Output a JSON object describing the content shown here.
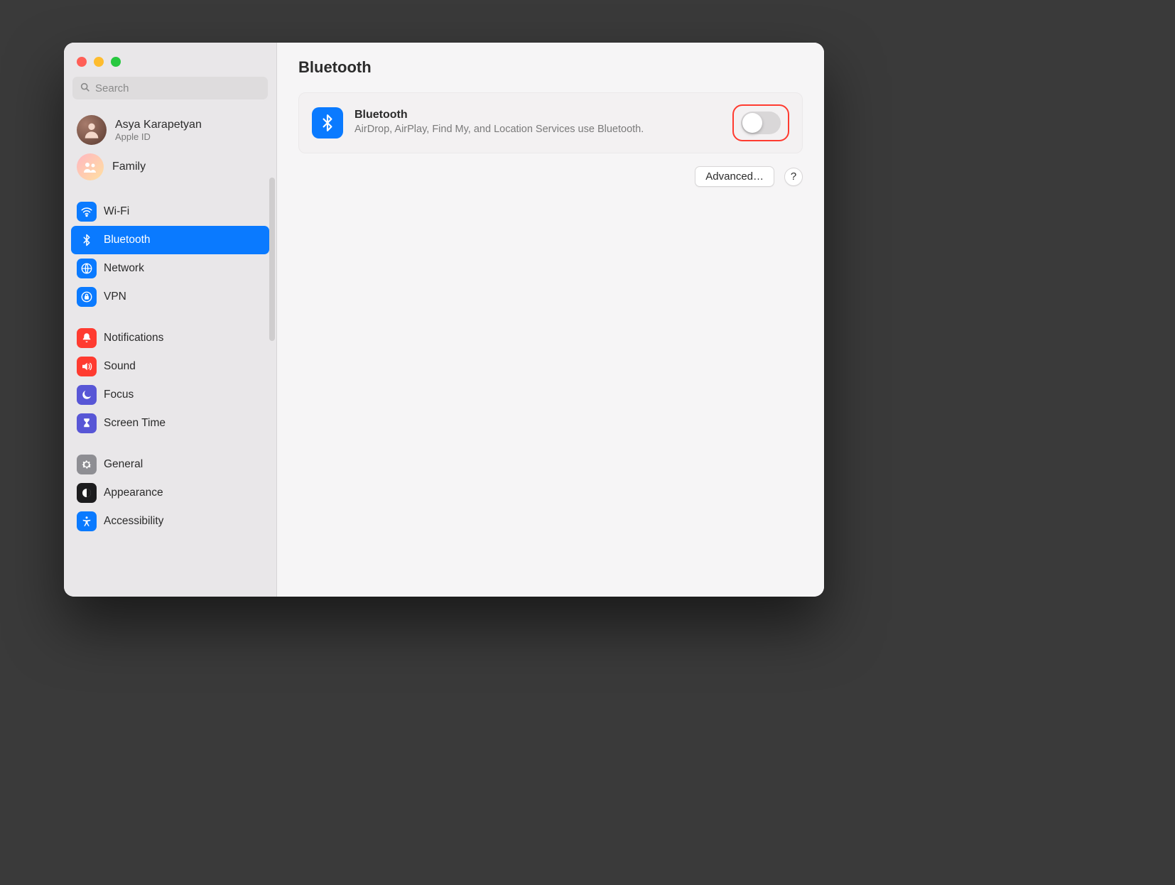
{
  "search": {
    "placeholder": "Search"
  },
  "profile": {
    "name": "Asya Karapetyan",
    "subtitle": "Apple ID"
  },
  "family": {
    "label": "Family"
  },
  "sidebar": {
    "groups": [
      {
        "items": [
          {
            "label": "Wi-Fi"
          },
          {
            "label": "Bluetooth"
          },
          {
            "label": "Network"
          },
          {
            "label": "VPN"
          }
        ]
      },
      {
        "items": [
          {
            "label": "Notifications"
          },
          {
            "label": "Sound"
          },
          {
            "label": "Focus"
          },
          {
            "label": "Screen Time"
          }
        ]
      },
      {
        "items": [
          {
            "label": "General"
          },
          {
            "label": "Appearance"
          },
          {
            "label": "Accessibility"
          }
        ]
      }
    ]
  },
  "page": {
    "title": "Bluetooth",
    "card": {
      "title": "Bluetooth",
      "desc": "AirDrop, AirPlay, Find My, and Location Services use Bluetooth.",
      "toggle_on": false
    },
    "advanced_label": "Advanced…",
    "help_label": "?"
  }
}
